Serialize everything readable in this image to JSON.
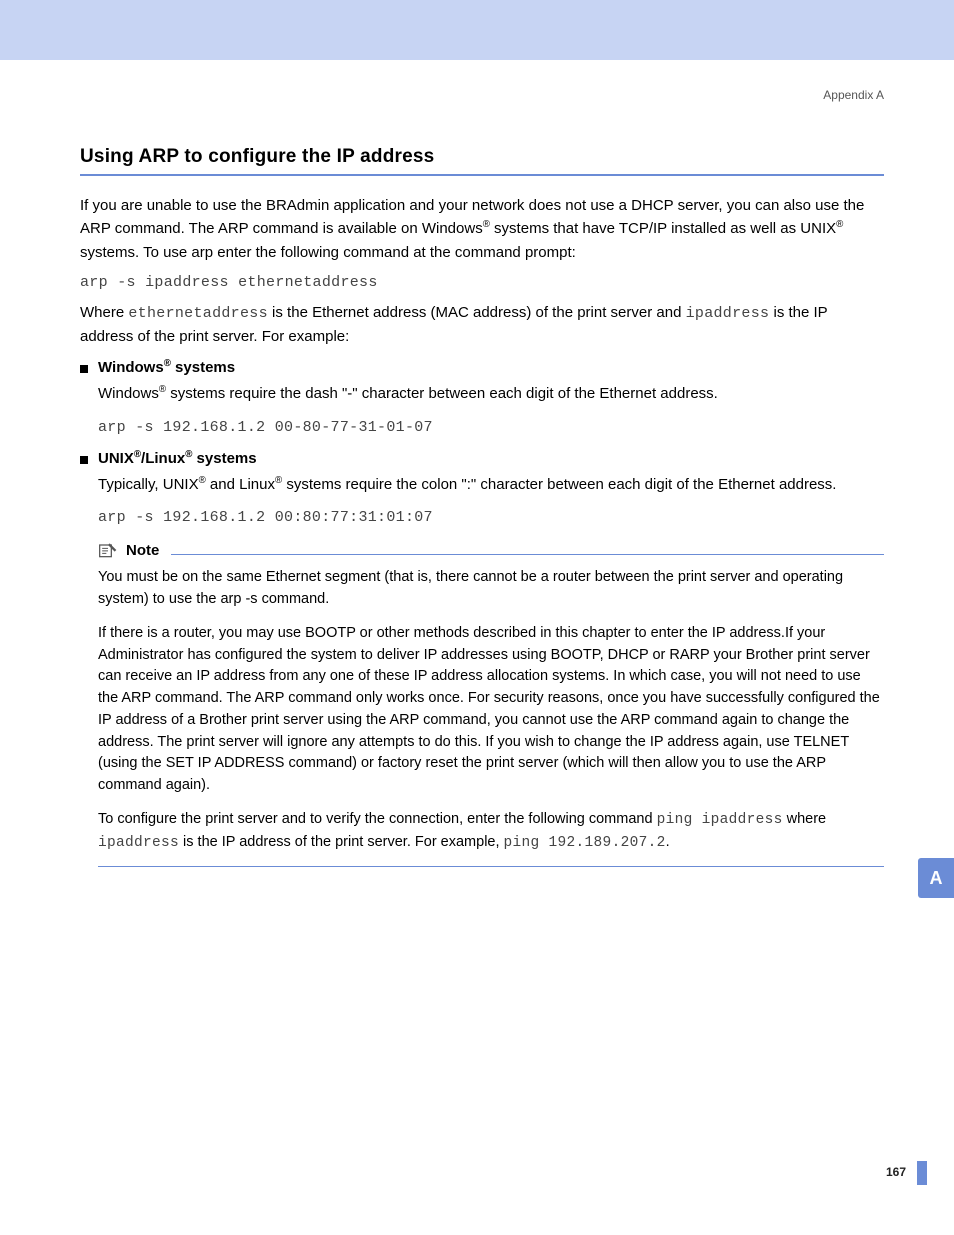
{
  "header": {
    "appendix": "Appendix A"
  },
  "title": "Using ARP to configure the IP address",
  "intro": {
    "p1a": "If you are unable to use the BRAdmin application and your network does not use a DHCP server, you can also use the ARP command. The ARP command is available on Windows",
    "p1b": " systems that have TCP/IP installed as well as UNIX",
    "p1c": " systems. To use arp enter the following command at the command prompt:",
    "code1": "arp -s ipaddress ethernetaddress",
    "p2a": "Where ",
    "p2code1": "ethernetaddress",
    "p2b": " is the Ethernet address (MAC address) of the print server and ",
    "p2code2": "ipaddress",
    "p2c": " is the IP address of the print server. For example:"
  },
  "windows": {
    "heading_a": "Windows",
    "heading_b": " systems",
    "body_a": "Windows",
    "body_b": " systems require the dash \"-\" character between each digit of the Ethernet address.",
    "code": "arp -s 192.168.1.2 00-80-77-31-01-07"
  },
  "unix": {
    "heading_a": "UNIX",
    "heading_b": "/Linux",
    "heading_c": " systems",
    "body_a": "Typically, UNIX",
    "body_b": " and Linux",
    "body_c": " systems require the colon \":\" character between each digit of the Ethernet address.",
    "code": "arp -s 192.168.1.2 00:80:77:31:01:07"
  },
  "note": {
    "label": "Note",
    "p1": "You must be on the same Ethernet segment (that is, there cannot be a router between the print server and operating system) to use the arp -s command.",
    "p2": "If there is a router, you may use BOOTP or other methods described in this chapter to enter the IP address.If your Administrator has configured the system to deliver IP addresses using BOOTP, DHCP or RARP your Brother print server can receive an IP address from any one of these IP address allocation systems. In which case, you will not need to use the ARP command. The ARP command only works once. For security reasons, once you have successfully configured the IP address of a Brother print server using the ARP command, you cannot use the ARP command again to change the address. The print server will ignore any attempts to do this. If you wish to change the IP address again, use TELNET (using the SET IP ADDRESS command) or factory reset the print server (which will then allow you to use the ARP command again).",
    "p3a": "To configure the print server and to verify the connection, enter the following command ",
    "p3code1": "ping ipaddress",
    "p3b": " where ",
    "p3code2": "ipaddress",
    "p3c": " is the IP address of the print server. For example, ",
    "p3code3": "ping 192.189.207.2",
    "p3d": "."
  },
  "sidebar": {
    "tab": "A"
  },
  "footer": {
    "page": "167"
  },
  "reg": "®"
}
